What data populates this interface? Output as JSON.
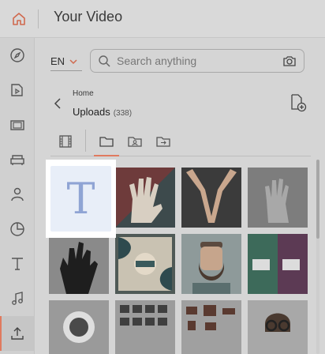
{
  "header": {
    "title": "Your Video",
    "home_icon": "home-icon"
  },
  "sidebar": {
    "items": [
      {
        "name": "compass",
        "icon": "compass-icon",
        "active": false
      },
      {
        "name": "media",
        "icon": "media-file-icon",
        "active": false
      },
      {
        "name": "clips",
        "icon": "clips-icon",
        "active": false
      },
      {
        "name": "scenes",
        "icon": "sofa-icon",
        "active": false
      },
      {
        "name": "characters",
        "icon": "person-icon",
        "active": false
      },
      {
        "name": "charts",
        "icon": "pie-chart-icon",
        "active": false
      },
      {
        "name": "text",
        "icon": "text-icon",
        "active": false
      },
      {
        "name": "music",
        "icon": "music-note-icon",
        "active": false
      },
      {
        "name": "uploads",
        "icon": "upload-icon",
        "active": true
      }
    ]
  },
  "toolbar": {
    "language": "EN",
    "search_placeholder": "Search anything"
  },
  "breadcrumb": {
    "parent": "Home",
    "current": "Uploads",
    "count": "(338)"
  },
  "tabs": [
    {
      "name": "video",
      "icon": "film-icon",
      "active": false
    },
    {
      "name": "folders",
      "icon": "folder-icon",
      "active": true
    },
    {
      "name": "characters",
      "icon": "character-folder-icon",
      "active": false
    },
    {
      "name": "import",
      "icon": "import-folder-icon",
      "active": false
    }
  ],
  "text_tile": {
    "glyph": "T"
  },
  "grid": {
    "items": [
      {
        "kind": "text-template"
      },
      {
        "kind": "image",
        "subject": "hands"
      },
      {
        "kind": "image",
        "subject": "hands"
      },
      {
        "kind": "image",
        "subject": "hand"
      },
      {
        "kind": "image",
        "subject": "hand"
      },
      {
        "kind": "image",
        "subject": "abstract"
      },
      {
        "kind": "image",
        "subject": "man"
      },
      {
        "kind": "image",
        "subject": "id-card"
      },
      {
        "kind": "image",
        "subject": "person"
      },
      {
        "kind": "image",
        "subject": "icons"
      },
      {
        "kind": "image",
        "subject": "objects"
      },
      {
        "kind": "image",
        "subject": "person"
      }
    ]
  },
  "colors": {
    "accent": "#e07a5f",
    "overlay": "#d3d3d3",
    "text_tile_bg": "#e8eef8",
    "text_tile_glyph": "#8fa4d4"
  }
}
